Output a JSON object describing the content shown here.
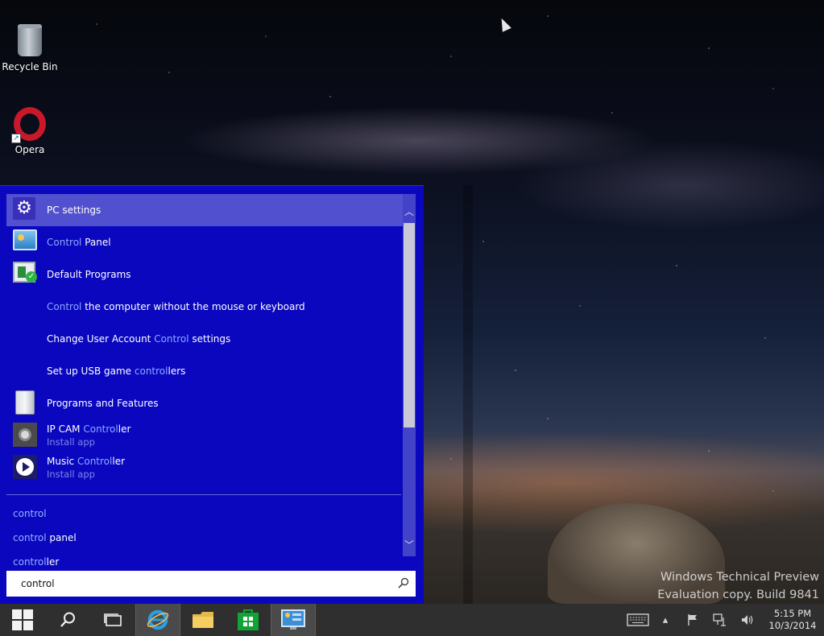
{
  "desktop": {
    "icons": [
      {
        "label": "Recycle Bin",
        "icon": "recycle-bin-icon"
      },
      {
        "label": "Opera",
        "icon": "opera-icon"
      }
    ],
    "watermark": {
      "line1": "Windows Technical Preview",
      "line2": "Evaluation copy. Build 9841"
    }
  },
  "start_menu": {
    "results": [
      {
        "icon": "gear-icon",
        "parts": [
          "PC settings"
        ],
        "selected": true
      },
      {
        "icon": "control-panel-icon",
        "pre": "",
        "hl": "Control",
        "post": " Panel"
      },
      {
        "icon": "default-programs-icon",
        "text": "Default Programs"
      },
      {
        "icon": "",
        "pre": "",
        "hl": "Control",
        "post": " the computer without the mouse or keyboard"
      },
      {
        "icon": "",
        "pre": "Change User Account ",
        "hl": "Control",
        "post": " settings"
      },
      {
        "icon": "",
        "pre": "Set up USB game ",
        "hl": "control",
        "post": "lers"
      },
      {
        "icon": "programs-features-icon",
        "text": "Programs and Features"
      },
      {
        "icon": "webcam-icon",
        "pre": "IP CAM ",
        "hl": "Control",
        "post": "ler",
        "sub": "Install app"
      },
      {
        "icon": "music-play-icon",
        "pre": "Music ",
        "hl": "Control",
        "post": "ler",
        "sub": "Install app"
      }
    ],
    "suggestions": [
      {
        "hl": "control",
        "post": ""
      },
      {
        "hl": "control",
        "post": " panel"
      },
      {
        "hl": "control",
        "post": "ler"
      }
    ],
    "search": {
      "value": "control"
    }
  },
  "taskbar": {
    "clock": {
      "time": "5:15 PM",
      "date": "10/3/2014"
    },
    "apps": [
      "start-button",
      "search-button",
      "task-view-button",
      "internet-explorer",
      "file-explorer",
      "store",
      "control-panel"
    ],
    "active_app": "control-panel"
  },
  "colors": {
    "start_menu_bg": "#0a07bf",
    "selected_bg": "#5151d0",
    "highlight_text": "#8fa8ff",
    "taskbar_bg": "#2f2f2f"
  }
}
